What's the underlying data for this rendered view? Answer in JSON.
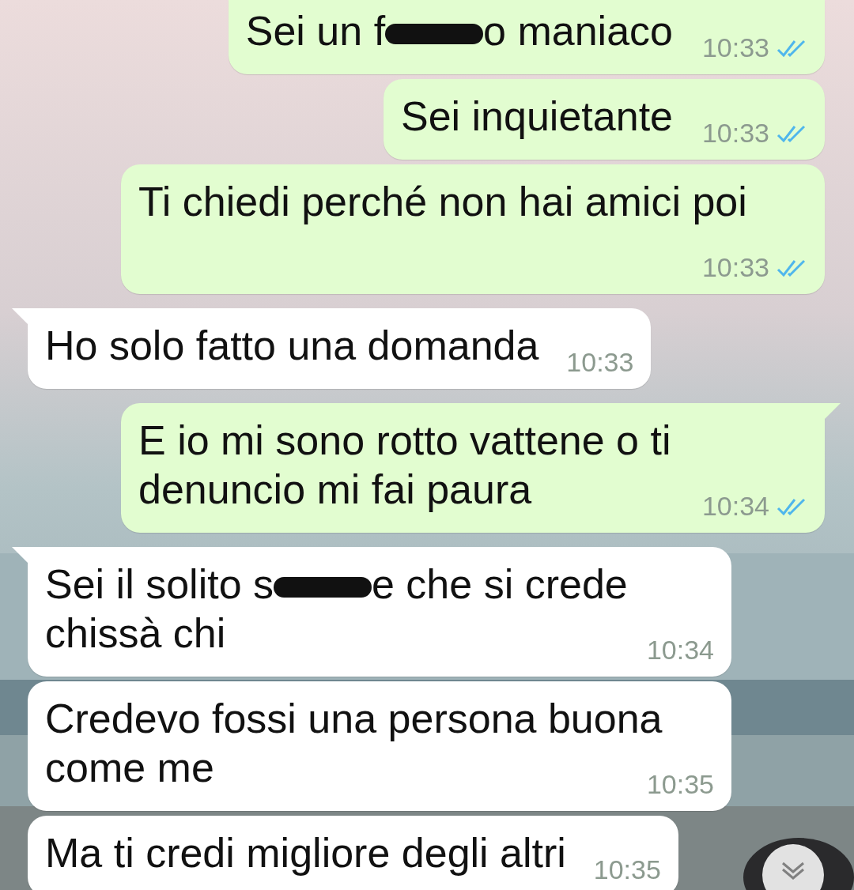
{
  "messages": [
    {
      "outgoing": true,
      "tail": false,
      "parts": [
        {
          "kind": "text",
          "text": "Sei un f"
        },
        {
          "kind": "redaction"
        },
        {
          "kind": "text",
          "text": "o maniaco"
        }
      ],
      "time": "10:33",
      "read": true
    },
    {
      "outgoing": true,
      "tail": false,
      "parts": [
        {
          "kind": "text",
          "text": "Sei inquietante"
        }
      ],
      "time": "10:33",
      "read": true
    },
    {
      "outgoing": true,
      "tail": false,
      "parts": [
        {
          "kind": "text",
          "text": "Ti chiedi perché non hai amici poi"
        }
      ],
      "time": "10:33",
      "read": true
    },
    {
      "outgoing": false,
      "tail": true,
      "parts": [
        {
          "kind": "text",
          "text": "Ho solo fatto una domanda"
        }
      ],
      "time": "10:33"
    },
    {
      "outgoing": true,
      "tail": true,
      "parts": [
        {
          "kind": "text",
          "text": "E io mi sono rotto vattene o ti"
        },
        {
          "kind": "text",
          "text": "denuncio mi fai paura"
        }
      ],
      "time": "10:34",
      "read": true
    },
    {
      "outgoing": false,
      "tail": true,
      "parts": [
        {
          "kind": "text",
          "text": "Sei il solito s"
        },
        {
          "kind": "redaction"
        },
        {
          "kind": "text",
          "text": "e che si crede"
        },
        {
          "kind": "text",
          "text": "chissà chi"
        }
      ],
      "time": "10:34"
    },
    {
      "outgoing": false,
      "tail": false,
      "parts": [
        {
          "kind": "text",
          "text": "Credevo fossi una persona buona"
        },
        {
          "kind": "text",
          "text": "come me"
        }
      ],
      "time": "10:35"
    },
    {
      "outgoing": false,
      "tail": false,
      "parts": [
        {
          "kind": "text",
          "text": "Ma ti credi migliore degli altri"
        }
      ],
      "time": "10:35"
    }
  ],
  "scroll_down_button": {
    "visible": true
  }
}
